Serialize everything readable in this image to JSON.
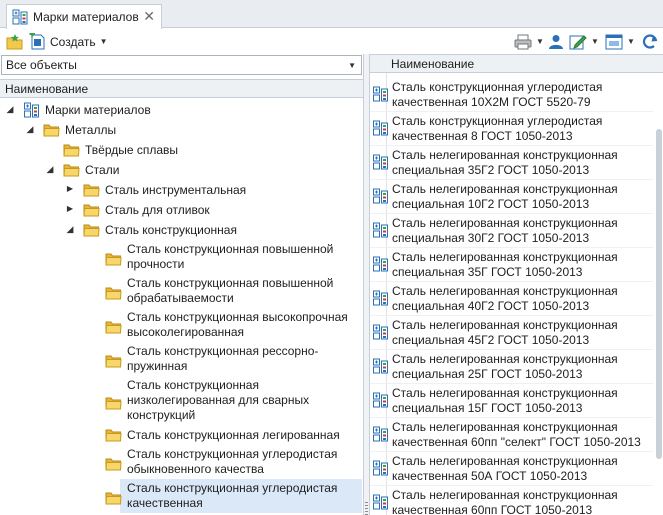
{
  "tab": {
    "title": "Марки материалов",
    "close_glyph": "✕",
    "icon": "materials-icon"
  },
  "toolbar": {
    "create_label": "Создать",
    "left_icons": [
      "star-folder-icon",
      "create-icon"
    ],
    "right_icons": [
      "print-icon",
      "user-icon",
      "edit-icon",
      "view-icon",
      "refresh-icon"
    ]
  },
  "filter": {
    "value": "Все объекты"
  },
  "left_header": "Наименование",
  "right_header": "Наименование",
  "tree": [
    {
      "level": 0,
      "expander": "expanded",
      "icon": "materials-icon",
      "lines": [
        "Марки материалов"
      ]
    },
    {
      "level": 1,
      "expander": "expanded",
      "icon": "folder-icon",
      "lines": [
        "Металлы"
      ]
    },
    {
      "level": 2,
      "expander": "none",
      "icon": "folder-icon",
      "lines": [
        "Твёрдые сплавы"
      ]
    },
    {
      "level": 2,
      "expander": "expanded",
      "icon": "folder-icon",
      "lines": [
        "Стали"
      ]
    },
    {
      "level": 3,
      "expander": "collapsed",
      "icon": "folder-icon",
      "lines": [
        "Сталь инструментальная"
      ]
    },
    {
      "level": 3,
      "expander": "collapsed",
      "icon": "folder-icon",
      "lines": [
        "Сталь для отливок"
      ]
    },
    {
      "level": 3,
      "expander": "expanded",
      "icon": "folder-icon",
      "lines": [
        "Сталь конструкционная"
      ]
    },
    {
      "level": 4,
      "expander": "none",
      "icon": "folder-icon",
      "lines": [
        "Сталь конструкционная повышенной",
        "прочности"
      ]
    },
    {
      "level": 4,
      "expander": "none",
      "icon": "folder-icon",
      "lines": [
        "Сталь конструкционная повышенной",
        "обрабатываемости"
      ]
    },
    {
      "level": 4,
      "expander": "none",
      "icon": "folder-icon",
      "lines": [
        "Сталь конструкционная высокопрочная",
        "высоколегированная"
      ]
    },
    {
      "level": 4,
      "expander": "none",
      "icon": "folder-icon",
      "lines": [
        "Сталь конструкционная рессорно-",
        "пружинная"
      ]
    },
    {
      "level": 4,
      "expander": "none",
      "icon": "folder-icon",
      "lines": [
        "Сталь конструкционная",
        "низколегированная для сварных",
        "конструкций"
      ]
    },
    {
      "level": 4,
      "expander": "none",
      "icon": "folder-icon",
      "lines": [
        "Сталь конструкционная легированная"
      ]
    },
    {
      "level": 4,
      "expander": "none",
      "icon": "folder-icon",
      "lines": [
        "Сталь конструкционная углеродистая",
        "обыкновенного качества"
      ]
    },
    {
      "level": 4,
      "expander": "none",
      "icon": "folder-icon",
      "selected": true,
      "lines": [
        "Сталь конструкционная углеродистая",
        "качественная"
      ]
    }
  ],
  "items": [
    {
      "lines": [
        "Сталь конструкционная углеродистая",
        "качественная 10Х2М ГОСТ 5520-79"
      ]
    },
    {
      "lines": [
        "Сталь конструкционная углеродистая",
        "качественная 8 ГОСТ 1050-2013"
      ]
    },
    {
      "lines": [
        "Сталь нелегированная конструкционная",
        "специальная 35Г2 ГОСТ 1050-2013"
      ]
    },
    {
      "lines": [
        "Сталь нелегированная конструкционная",
        "специальная 10Г2 ГОСТ 1050-2013"
      ]
    },
    {
      "lines": [
        "Сталь нелегированная конструкционная",
        "специальная 30Г2 ГОСТ 1050-2013"
      ]
    },
    {
      "lines": [
        "Сталь нелегированная конструкционная",
        "специальная 35Г ГОСТ 1050-2013"
      ]
    },
    {
      "lines": [
        "Сталь нелегированная конструкционная",
        "специальная 40Г2 ГОСТ 1050-2013"
      ]
    },
    {
      "lines": [
        "Сталь нелегированная конструкционная",
        "специальная 45Г2 ГОСТ 1050-2013"
      ]
    },
    {
      "lines": [
        "Сталь нелегированная конструкционная",
        "специальная 25Г ГОСТ 1050-2013"
      ]
    },
    {
      "lines": [
        "Сталь нелегированная конструкционная",
        "специальная 15Г ГОСТ 1050-2013"
      ]
    },
    {
      "lines": [
        "Сталь нелегированная конструкционная",
        "качественная 60пп \"селект\" ГОСТ 1050-2013"
      ]
    },
    {
      "lines": [
        "Сталь нелегированная конструкционная",
        "качественная 50А ГОСТ 1050-2013"
      ]
    },
    {
      "lines": [
        "Сталь нелегированная конструкционная",
        "качественная 60пп ГОСТ 1050-2013"
      ]
    }
  ],
  "colors": {
    "accent": "#2a6fb8",
    "selection": "#dbe8f7",
    "folder": "#f2c94c"
  }
}
